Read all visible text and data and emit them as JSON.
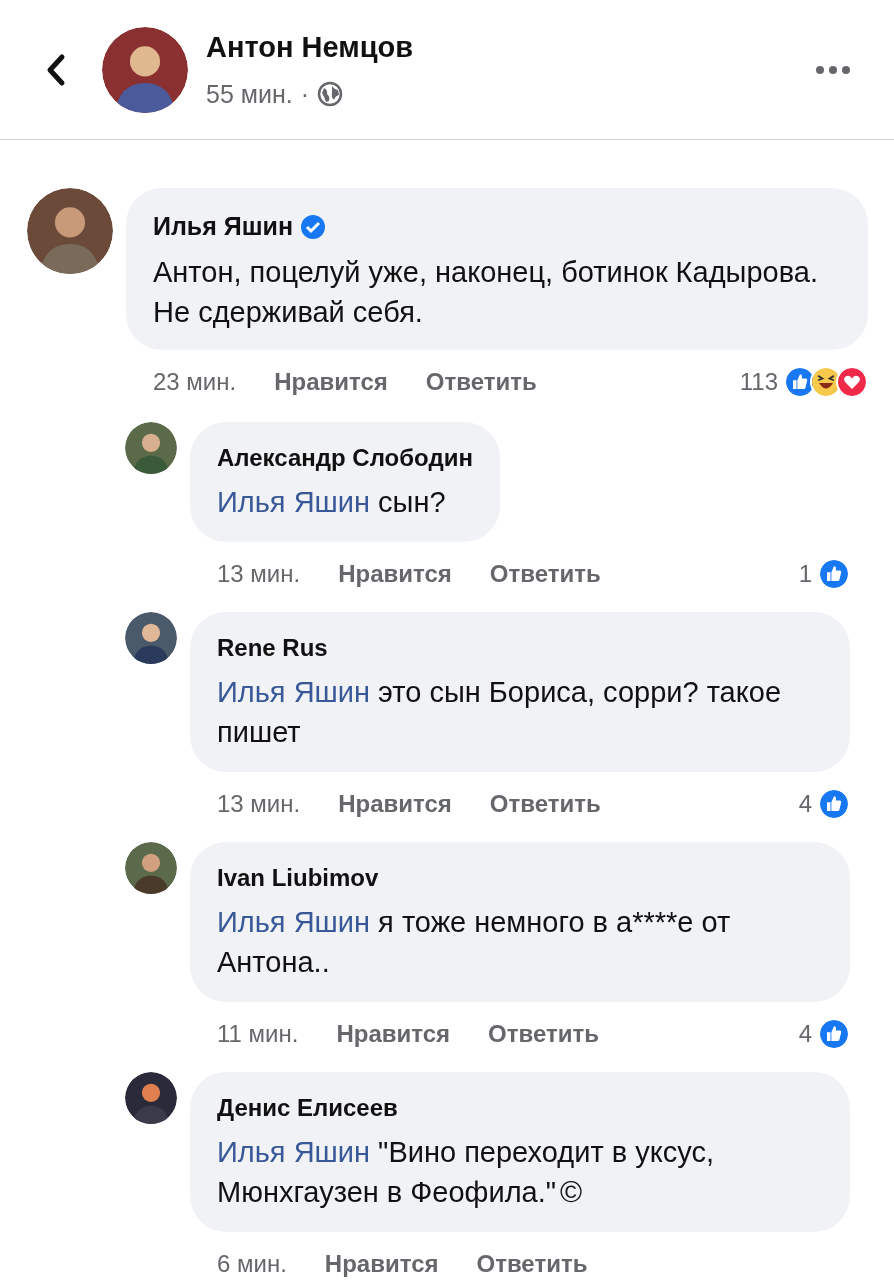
{
  "header": {
    "name": "Антон Немцов",
    "time": "55 мин.",
    "separator": "·",
    "privacy": {
      "kind": "public"
    }
  },
  "comments": [
    {
      "author": "Илья Яшин",
      "verified": true,
      "text": "Антон, поцелуй уже, наконец, ботинок Кадырова. Не сдерживай себя.",
      "time": "23 мин.",
      "like": "Нравится",
      "reply": "Ответить",
      "count": "113",
      "reactions": [
        {
          "kind": "like"
        },
        {
          "kind": "haha"
        },
        {
          "kind": "love"
        }
      ],
      "children": [
        {
          "author": "Александр Слободин",
          "verified": false,
          "mention": "Илья Яшин",
          "text": " сын?",
          "time": "13 мин.",
          "like": "Нравится",
          "reply": "Ответить",
          "count": "1",
          "reactions": [
            {
              "kind": "like"
            }
          ]
        },
        {
          "author": "Rene Rus",
          "verified": false,
          "mention": "Илья Яшин",
          "text": "это сын Бориса, сорри? такое пишет",
          "time": "13 мин.",
          "like": "Нравится",
          "reply": "Ответить",
          "count": "4",
          "reactions": [
            {
              "kind": "like"
            }
          ]
        },
        {
          "author": "Ivan Liubimov",
          "verified": false,
          "mention": "Илья Яшин",
          "text": "я тоже немного в а****е от Антона..",
          "time": "11 мин.",
          "like": "Нравится",
          "reply": "Ответить",
          "count": "4",
          "reactions": [
            {
              "kind": "like"
            }
          ]
        },
        {
          "author": "Денис Елисеев",
          "verified": false,
          "mention": "Илья Яшин",
          "text": "\"Вино переходит в уксус, Мюнхгаузен в Феофила.\"",
          "copyright": "©",
          "time": "6 мин.",
          "like": "Нравится",
          "reply": "Ответить"
        }
      ]
    }
  ]
}
